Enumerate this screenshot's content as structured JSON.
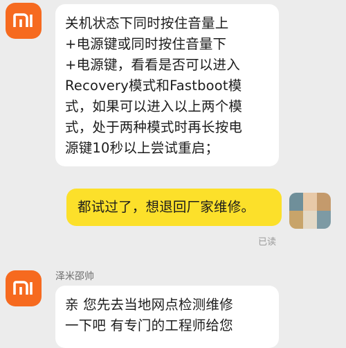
{
  "messages": [
    {
      "direction": "incoming",
      "lines": [
        "关机状态下同时按住音量上",
        "+电源键或同时按住音量下",
        "+电源键，看看是否可以进入",
        "Recovery模式和Fastboot模",
        "式，如果可以进入以上两个模",
        "式，处于两种模式时再长按电",
        "源键10秒以上尝试重启；"
      ]
    },
    {
      "direction": "outgoing",
      "text": "都试过了，想退回厂家维修。",
      "status": "已读"
    },
    {
      "direction": "incoming",
      "sender": "泽米邵帅",
      "lines": [
        "亲 您先去当地网点检测维修",
        "一下吧 有专门的工程师给您"
      ]
    }
  ],
  "avatar_icon": "mi-logo-icon",
  "colors": {
    "background": "#ececec",
    "incoming_bubble": "#ffffff",
    "outgoing_bubble": "#fce02a",
    "mi_orange": "#f66a1f"
  }
}
